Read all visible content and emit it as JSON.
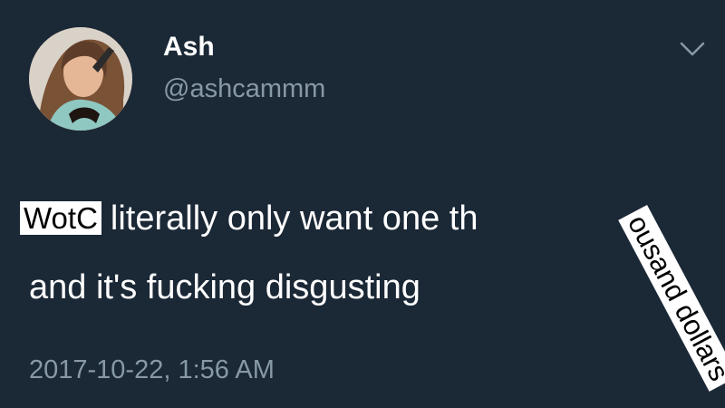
{
  "tweet": {
    "display_name": "Ash",
    "handle": "@ashcammm",
    "overlay_word": "WotC",
    "text_line1": "literally only want one th",
    "text_line2": "and it's fucking disgusting",
    "overlay_sticker": "ousand dollars",
    "timestamp": "2017-10-22, 1:56 AM",
    "menu_icon": "chevron-down-icon",
    "avatar_icon": "profile-photo"
  },
  "colors": {
    "background": "#1b2836",
    "primary_text": "#ffffff",
    "secondary_text": "#8899a6"
  }
}
